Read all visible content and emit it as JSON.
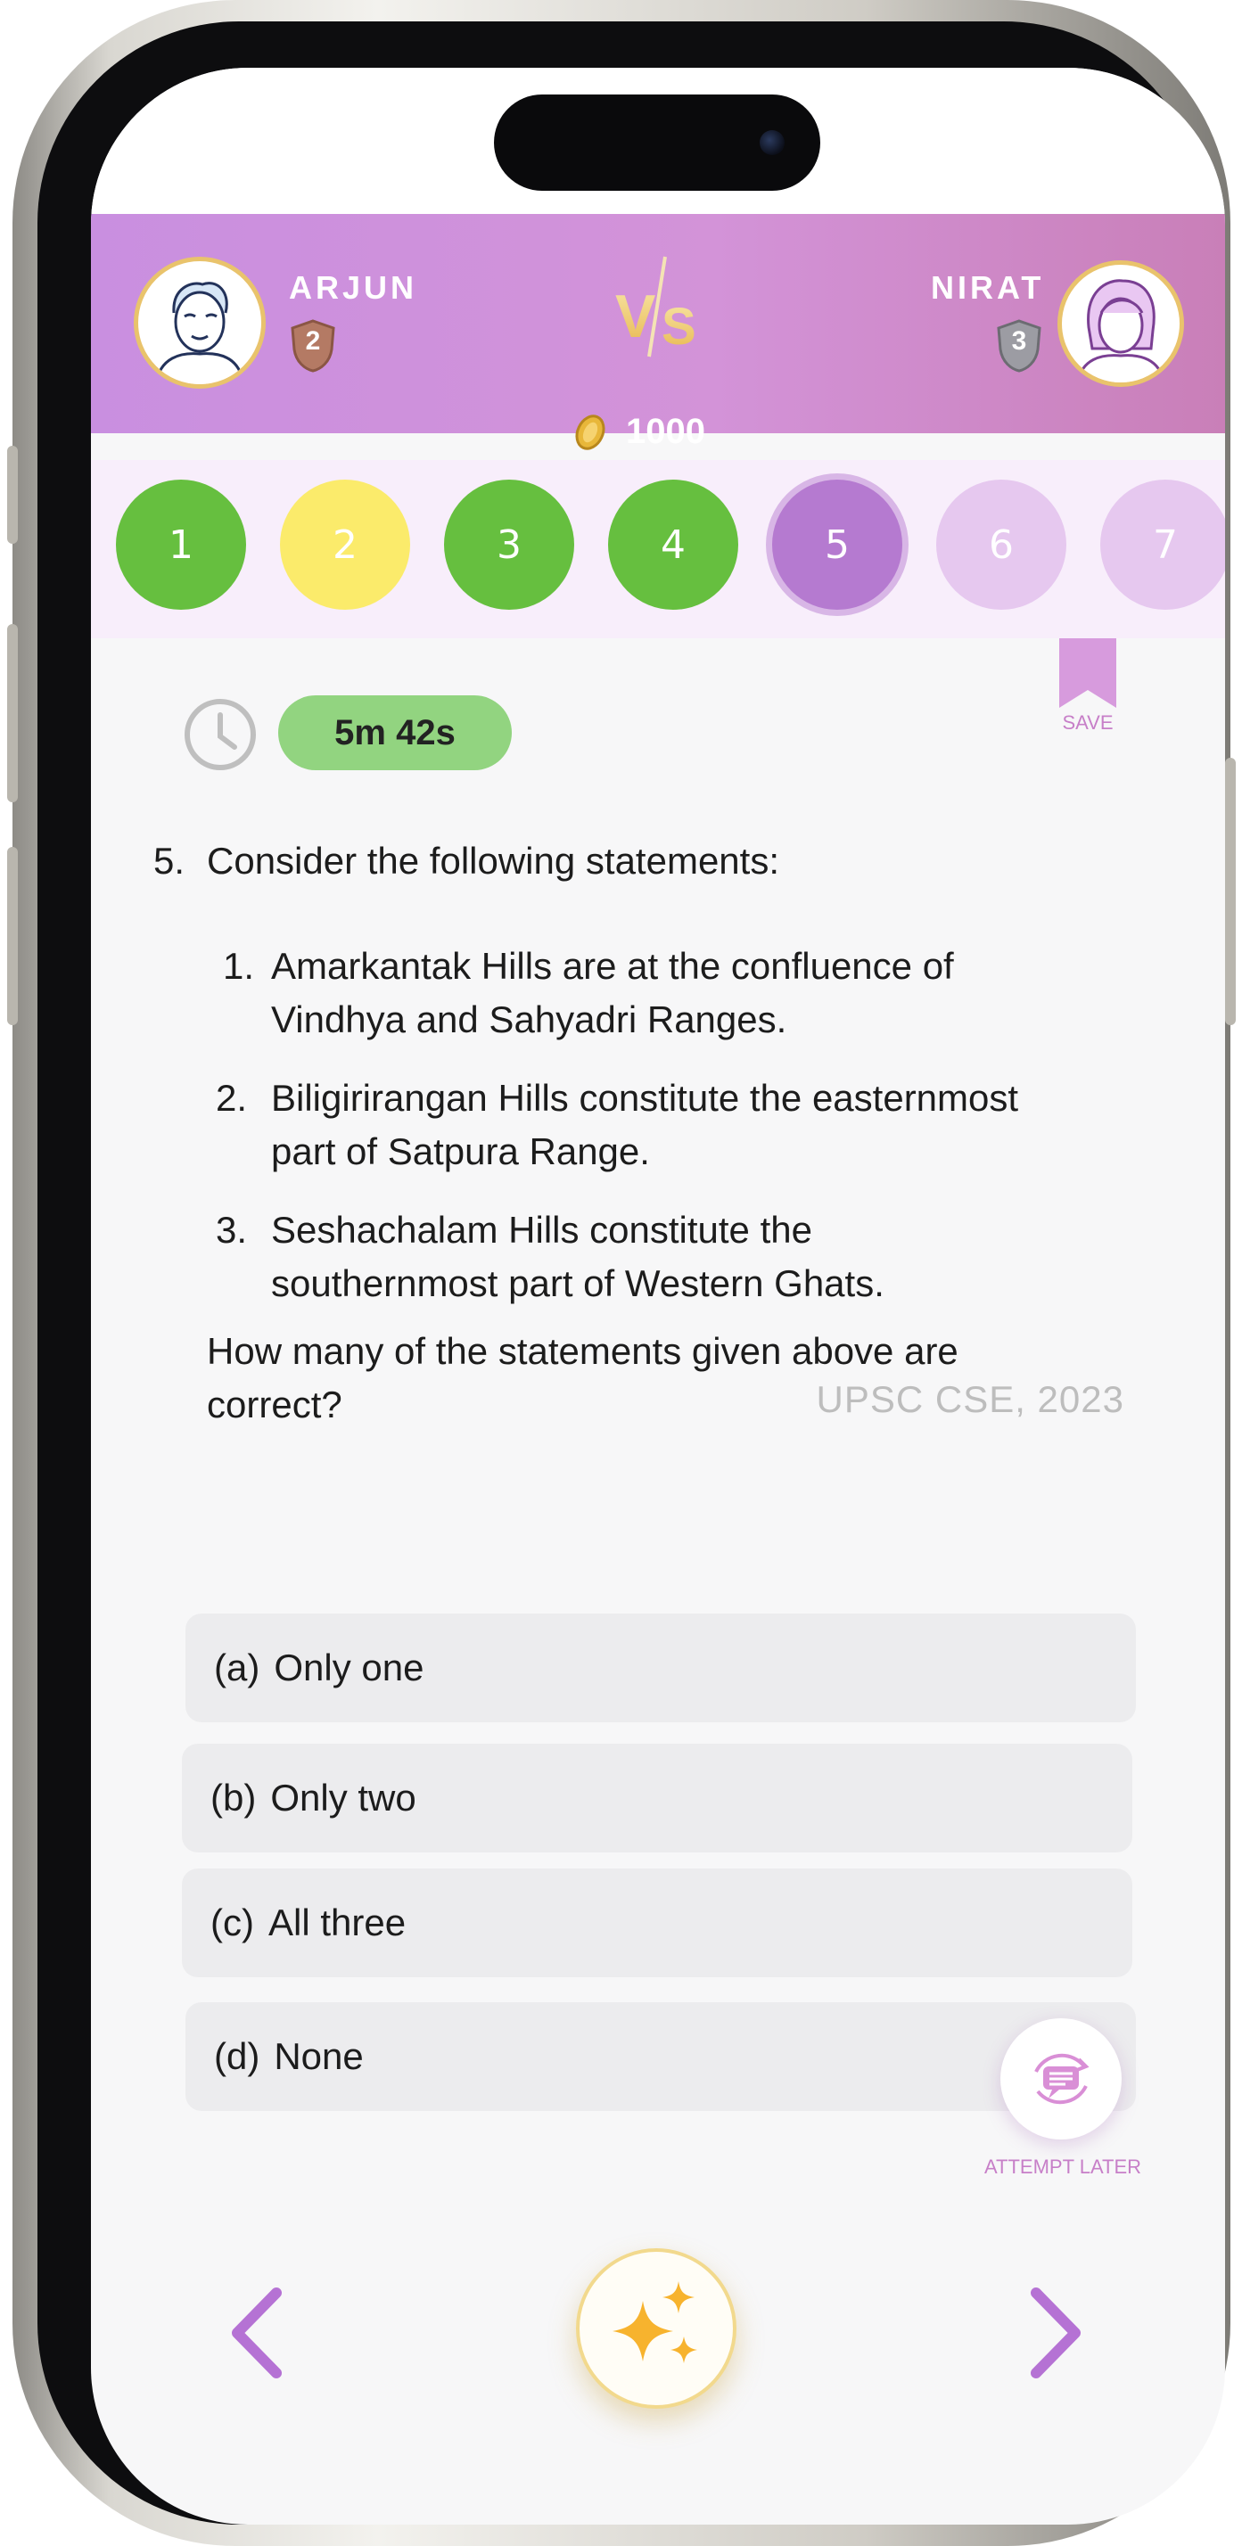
{
  "players": {
    "left": {
      "name": "ARJUN",
      "rank": "2"
    },
    "right": {
      "name": "NIRAT",
      "rank": "3"
    },
    "versus_label": "V/S",
    "coins": "1000"
  },
  "question_numbers": [
    {
      "label": "1",
      "status": "correct"
    },
    {
      "label": "2",
      "status": "skipped"
    },
    {
      "label": "3",
      "status": "correct"
    },
    {
      "label": "4",
      "status": "correct"
    },
    {
      "label": "5",
      "status": "current"
    },
    {
      "label": "6",
      "status": "unanswered"
    },
    {
      "label": "7",
      "status": "unanswered"
    }
  ],
  "timer": {
    "value": "5m 42s"
  },
  "save": {
    "label": "SAVE"
  },
  "question": {
    "number": "5.",
    "intro": "Consider the following statements:",
    "statements": [
      {
        "num": "1.",
        "line1": "Amarkantak Hills are at the confluence of",
        "line2": "Vindhya and Sahyadri Ranges."
      },
      {
        "num": "2.",
        "line1": "Biligirirangan Hills constitute the easternmost",
        "line2": "part of Satpura Range."
      },
      {
        "num": "3.",
        "line1": "Seshachalam Hills constitute the",
        "line2": "southernmost part of Western Ghats."
      }
    ],
    "prompt_line1": "How many of the statements given above are",
    "prompt_line2": "correct?",
    "source": "UPSC CSE, 2023"
  },
  "options": [
    {
      "letter": "(a)",
      "text": "Only one"
    },
    {
      "letter": "(b)",
      "text": "Only two"
    },
    {
      "letter": "(c)",
      "text": "All three"
    },
    {
      "letter": "(d)",
      "text": "None"
    }
  ],
  "attempt_later": {
    "label": "ATTEMPT LATER"
  },
  "colors": {
    "header_gradient_start": "#c98fe0",
    "header_gradient_end": "#c97fb8",
    "correct": "#66bf3f",
    "skipped": "#fbeb6b",
    "current": "#b57ad0",
    "unanswered": "#e6c8ef",
    "accent": "#c77fc8"
  },
  "icons": [
    "clock-icon",
    "bookmark-icon",
    "chat-refresh-icon",
    "chevron-left-icon",
    "chevron-right-icon",
    "sparkles-icon",
    "coin-icon",
    "rank-shield-icon"
  ]
}
